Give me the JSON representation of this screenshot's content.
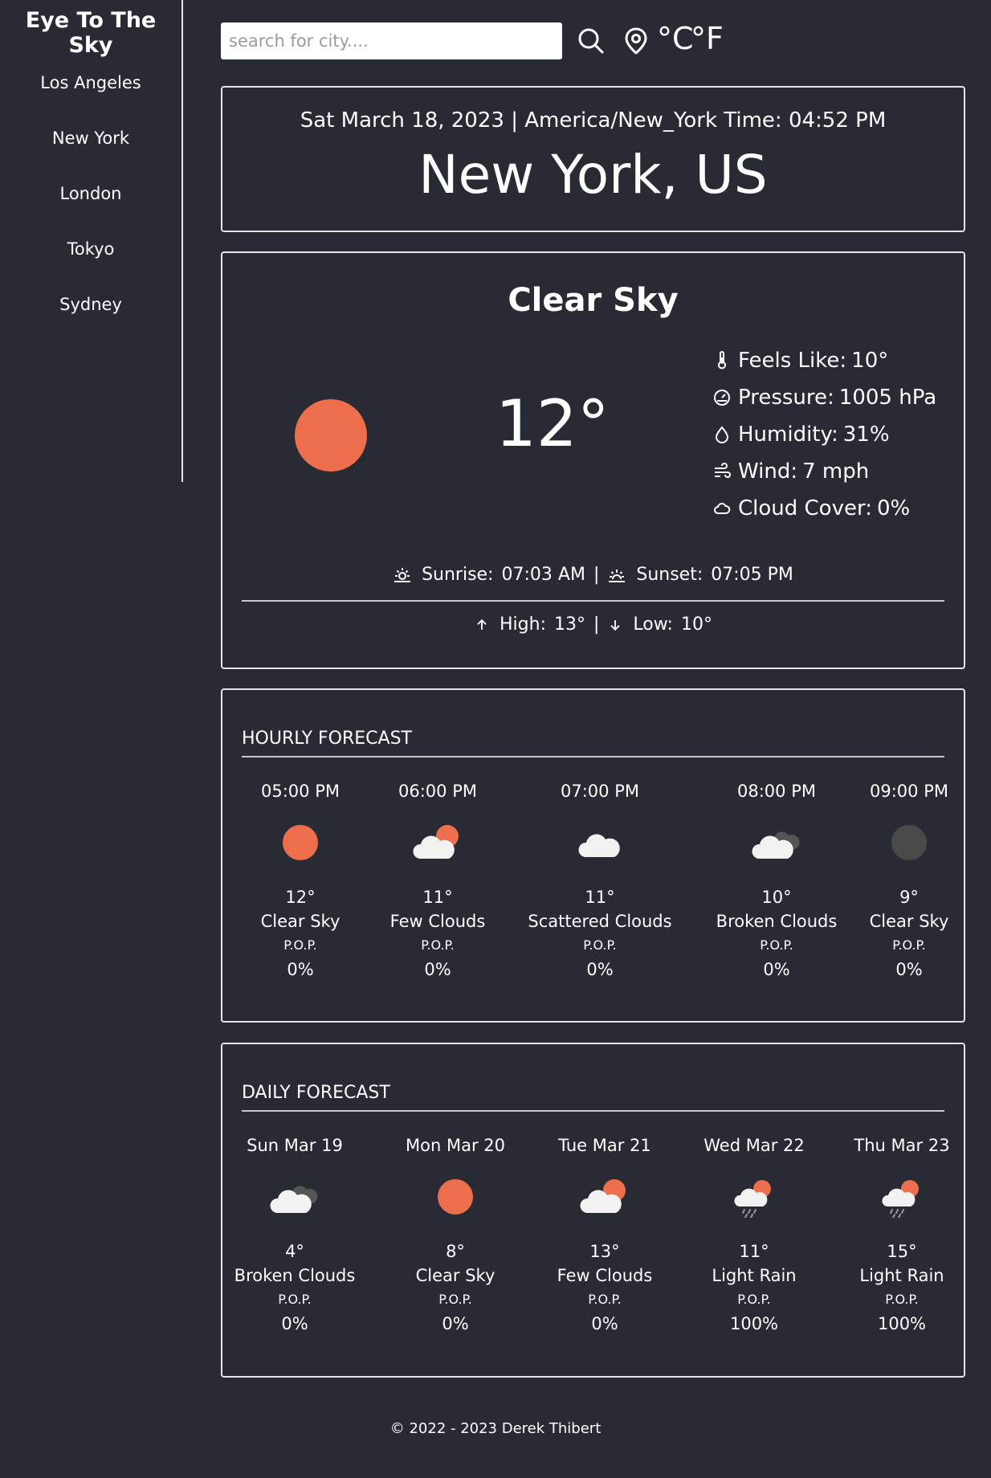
{
  "sidebar": {
    "brand": "Eye To The Sky",
    "cities": [
      "Los Angeles",
      "New York",
      "London",
      "Tokyo",
      "Sydney"
    ]
  },
  "topbar": {
    "search_placeholder": "search for city....",
    "unit_c": "°C",
    "unit_f": "°F"
  },
  "header": {
    "datetime": "Sat March 18, 2023 | America/New_York Time: 04:52 PM",
    "location": "New York, US"
  },
  "current": {
    "condition": "Clear Sky",
    "temp": "12°",
    "feels_like_label": "Feels Like:",
    "feels_like": "10°",
    "pressure_label": "Pressure:",
    "pressure": "1005 hPa",
    "humidity_label": "Humidity:",
    "humidity": "31%",
    "wind_label": "Wind:",
    "wind": "7 mph",
    "cloud_label": "Cloud Cover:",
    "cloud": "0%",
    "sunrise_label": "Sunrise:",
    "sunrise": "07:03 AM",
    "sunset_label": "Sunset:",
    "sunset": "07:05 PM",
    "high_label": "High:",
    "high": "13°",
    "low_label": "Low:",
    "low": "10°",
    "separator": "|"
  },
  "hourly": {
    "title": "HOURLY FORECAST",
    "pop_label": "P.O.P.",
    "items": [
      {
        "time": "05:00 PM",
        "temp": "12°",
        "desc": "Clear Sky",
        "pop": "0%",
        "icon": "sun-icon"
      },
      {
        "time": "06:00 PM",
        "temp": "11°",
        "desc": "Few Clouds",
        "pop": "0%",
        "icon": "few-clouds-icon"
      },
      {
        "time": "07:00 PM",
        "temp": "11°",
        "desc": "Scattered Clouds",
        "pop": "0%",
        "icon": "cloud-icon"
      },
      {
        "time": "08:00 PM",
        "temp": "10°",
        "desc": "Broken Clouds",
        "pop": "0%",
        "icon": "broken-clouds-icon"
      },
      {
        "time": "09:00 PM",
        "temp": "9°",
        "desc": "Clear Sky",
        "pop": "0%",
        "icon": "moon-icon"
      }
    ]
  },
  "daily": {
    "title": "DAILY FORECAST",
    "pop_label": "P.O.P.",
    "items": [
      {
        "day": "Sun Mar 19",
        "temp": "4°",
        "desc": "Broken Clouds",
        "pop": "0%",
        "icon": "broken-clouds-icon"
      },
      {
        "day": "Mon Mar 20",
        "temp": "8°",
        "desc": "Clear Sky",
        "pop": "0%",
        "icon": "sun-icon"
      },
      {
        "day": "Tue Mar 21",
        "temp": "13°",
        "desc": "Few Clouds",
        "pop": "0%",
        "icon": "few-clouds-icon"
      },
      {
        "day": "Wed Mar 22",
        "temp": "11°",
        "desc": "Light Rain",
        "pop": "100%",
        "icon": "light-rain-icon"
      },
      {
        "day": "Thu Mar 23",
        "temp": "15°",
        "desc": "Light Rain",
        "pop": "100%",
        "icon": "light-rain-icon"
      }
    ]
  },
  "footer": {
    "text": "© 2022 - 2023 Derek Thibert"
  },
  "colors": {
    "background": "#282b33",
    "sun": "#ec6e4c",
    "cloud": "#f2f2f2",
    "dark_cloud": "#555555",
    "night": "#4a4a4a"
  }
}
